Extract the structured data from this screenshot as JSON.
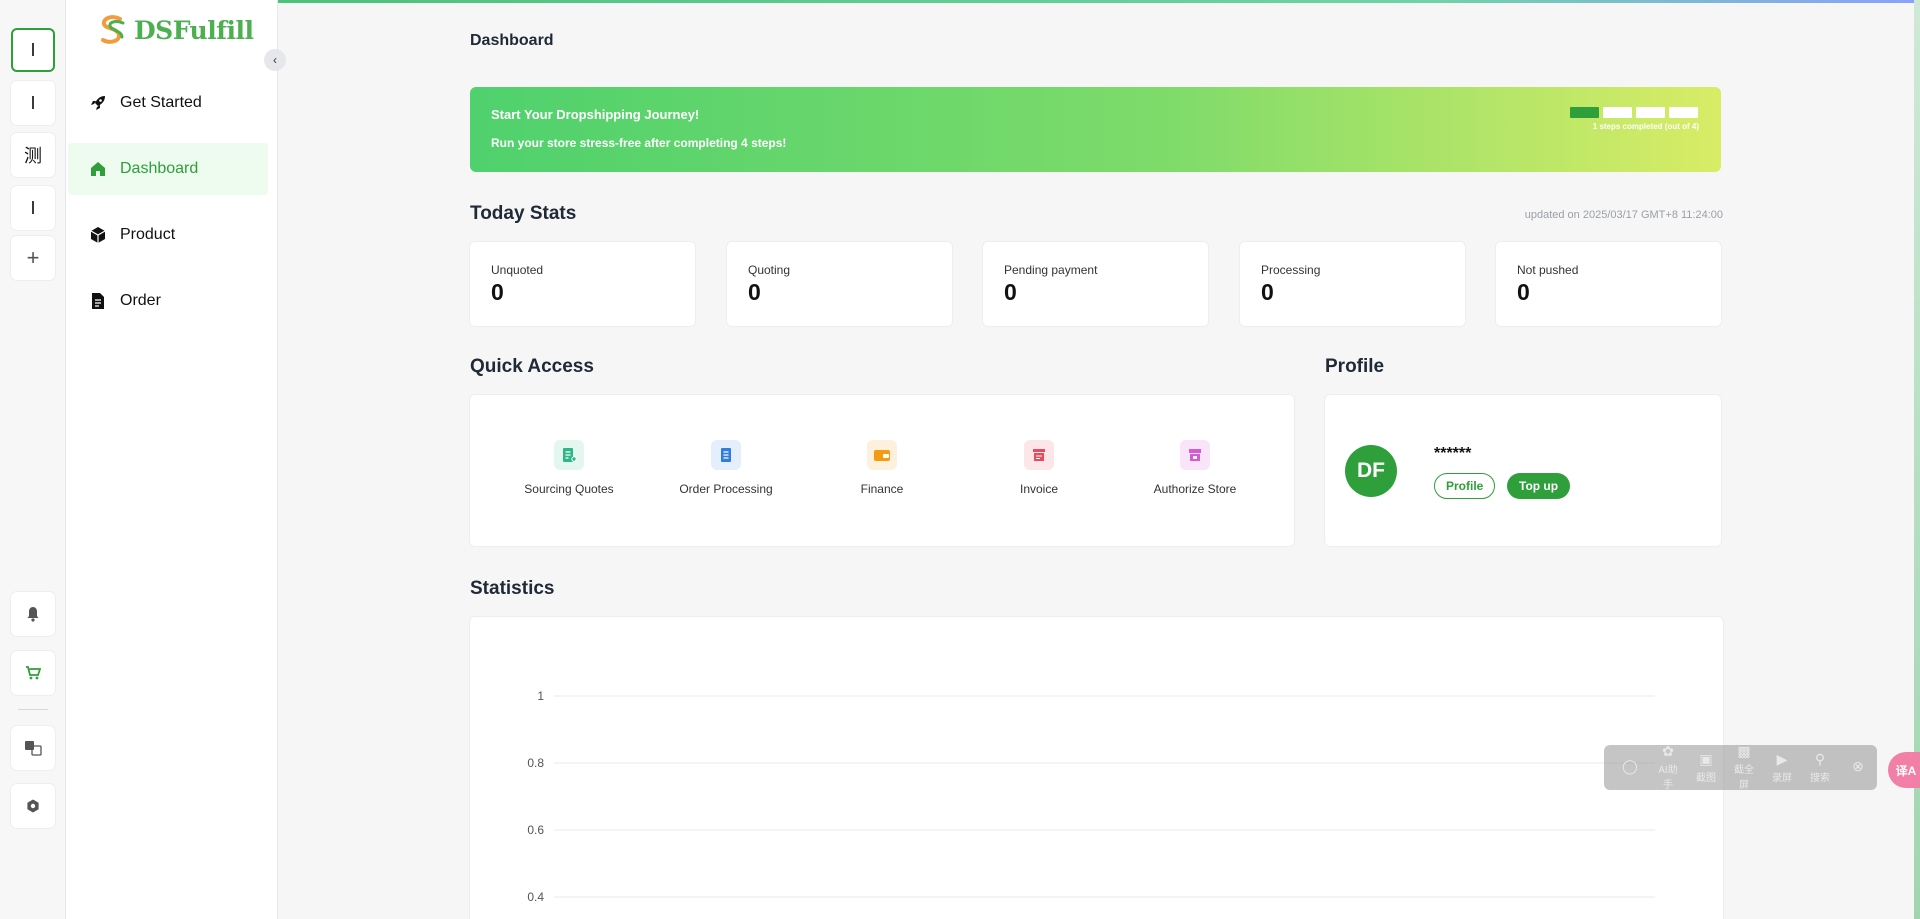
{
  "rail": {
    "items": [
      {
        "label": "I",
        "active": true
      },
      {
        "label": "I"
      },
      {
        "label": "测"
      },
      {
        "label": "I"
      },
      {
        "label": "+"
      }
    ]
  },
  "brand": {
    "name": "DSFulfill",
    "color": "#4caf50",
    "accent": "#2e9f3a"
  },
  "nav": {
    "items": [
      {
        "label": "Get Started",
        "icon": "rocket-icon"
      },
      {
        "label": "Dashboard",
        "icon": "home-icon",
        "active": true
      },
      {
        "label": "Product",
        "icon": "box-icon"
      },
      {
        "label": "Order",
        "icon": "document-icon"
      }
    ]
  },
  "page": {
    "title": "Dashboard"
  },
  "banner": {
    "title": "Start Your Dropshipping Journey!",
    "subtitle": "Run your store stress-free after completing 4 steps!",
    "steps_completed": 1,
    "steps_total": 4,
    "steps_label": "1 steps completed (out of 4)"
  },
  "today_stats": {
    "title": "Today Stats",
    "updated": "updated on 2025/03/17 GMT+8 11:24:00",
    "cards": [
      {
        "label": "Unquoted",
        "value": "0"
      },
      {
        "label": "Quoting",
        "value": "0"
      },
      {
        "label": "Pending payment",
        "value": "0"
      },
      {
        "label": "Processing",
        "value": "0"
      },
      {
        "label": "Not pushed",
        "value": "0"
      }
    ]
  },
  "quick_access": {
    "title": "Quick Access",
    "items": [
      {
        "label": "Sourcing Quotes",
        "icon": "quote-icon",
        "color": "#2fb58a",
        "bg": "#e3f7ef"
      },
      {
        "label": "Order Processing",
        "icon": "order-icon",
        "color": "#2f7de1",
        "bg": "#e4eefc"
      },
      {
        "label": "Finance",
        "icon": "wallet-icon",
        "color": "#f39c12",
        "bg": "#fdf0dc"
      },
      {
        "label": "Invoice",
        "icon": "invoice-icon",
        "color": "#e74c5c",
        "bg": "#fde6e8"
      },
      {
        "label": "Authorize Store",
        "icon": "store-icon",
        "color": "#d45bd8",
        "bg": "#f9e4fa"
      }
    ]
  },
  "profile": {
    "title": "Profile",
    "initials": "DF",
    "name": "******",
    "profile_button": "Profile",
    "topup_button": "Top up"
  },
  "statistics": {
    "title": "Statistics"
  },
  "chart_data": {
    "type": "line",
    "yticks": [
      "1",
      "0.8",
      "0.6",
      "0.4"
    ],
    "ylim": [
      0,
      1
    ],
    "grid": true,
    "series": []
  },
  "float_toolbar": {
    "items": [
      {
        "label": "",
        "icon": "shield-icon"
      },
      {
        "label": "AI助手",
        "icon": "ai-icon"
      },
      {
        "label": "截图",
        "icon": "camera-icon"
      },
      {
        "label": "截全屏",
        "icon": "screen-icon"
      },
      {
        "label": "录屏",
        "icon": "video-icon"
      },
      {
        "label": "搜索",
        "icon": "search-icon"
      },
      {
        "label": "",
        "icon": "close-icon"
      }
    ],
    "translate": "译A"
  }
}
